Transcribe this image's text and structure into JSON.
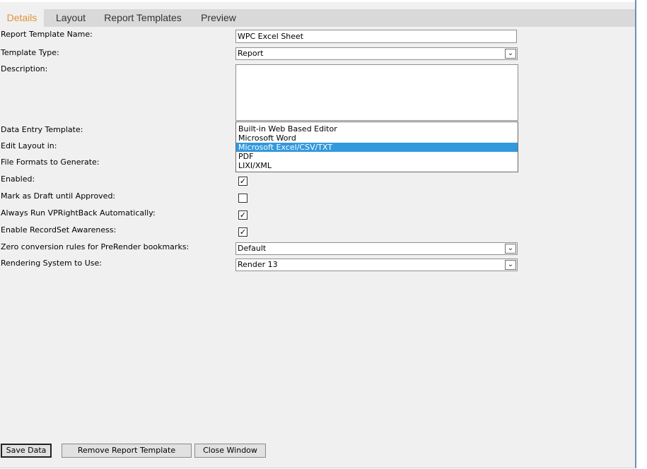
{
  "tabs": [
    {
      "label": "Details",
      "active": true
    },
    {
      "label": "Layout",
      "active": false
    },
    {
      "label": "Report Templates",
      "active": false
    },
    {
      "label": "Preview",
      "active": false
    }
  ],
  "form": {
    "name_label": "Report Template Name:",
    "name_value": "WPC Excel Sheet",
    "type_label": "Template Type:",
    "type_value": "Report",
    "description_label": "Description:",
    "description_value": "",
    "data_entry_label": "Data Entry Template:",
    "edit_layout_label": "Edit Layout in:",
    "file_formats_label": "File Formats to Generate:",
    "file_format_options": [
      {
        "label": "Built-in Web Based Editor",
        "selected": false
      },
      {
        "label": "Microsoft Word",
        "selected": false
      },
      {
        "label": "Microsoft Excel/CSV/TXT",
        "selected": true
      },
      {
        "label": "PDF",
        "selected": false
      },
      {
        "label": "LIXI/XML",
        "selected": false
      }
    ],
    "enabled_label": "Enabled:",
    "enabled_checked": true,
    "draft_label": "Mark as Draft until Approved:",
    "draft_checked": false,
    "vprightback_label": "Always Run VPRightBack Automatically:",
    "vprightback_checked": true,
    "recordset_label": "Enable RecordSet Awareness:",
    "recordset_checked": true,
    "zero_rules_label": "Zero conversion rules for PreRender bookmarks:",
    "zero_rules_value": "Default",
    "rendering_label": "Rendering System to Use:",
    "rendering_value": "Render 13"
  },
  "buttons": {
    "save": "Save Data",
    "remove": "Remove Report Template",
    "close": "Close Window"
  },
  "colors": {
    "active_tab": "#e2923a",
    "selection": "#3399dd",
    "window_border": "#6d8fb8"
  }
}
